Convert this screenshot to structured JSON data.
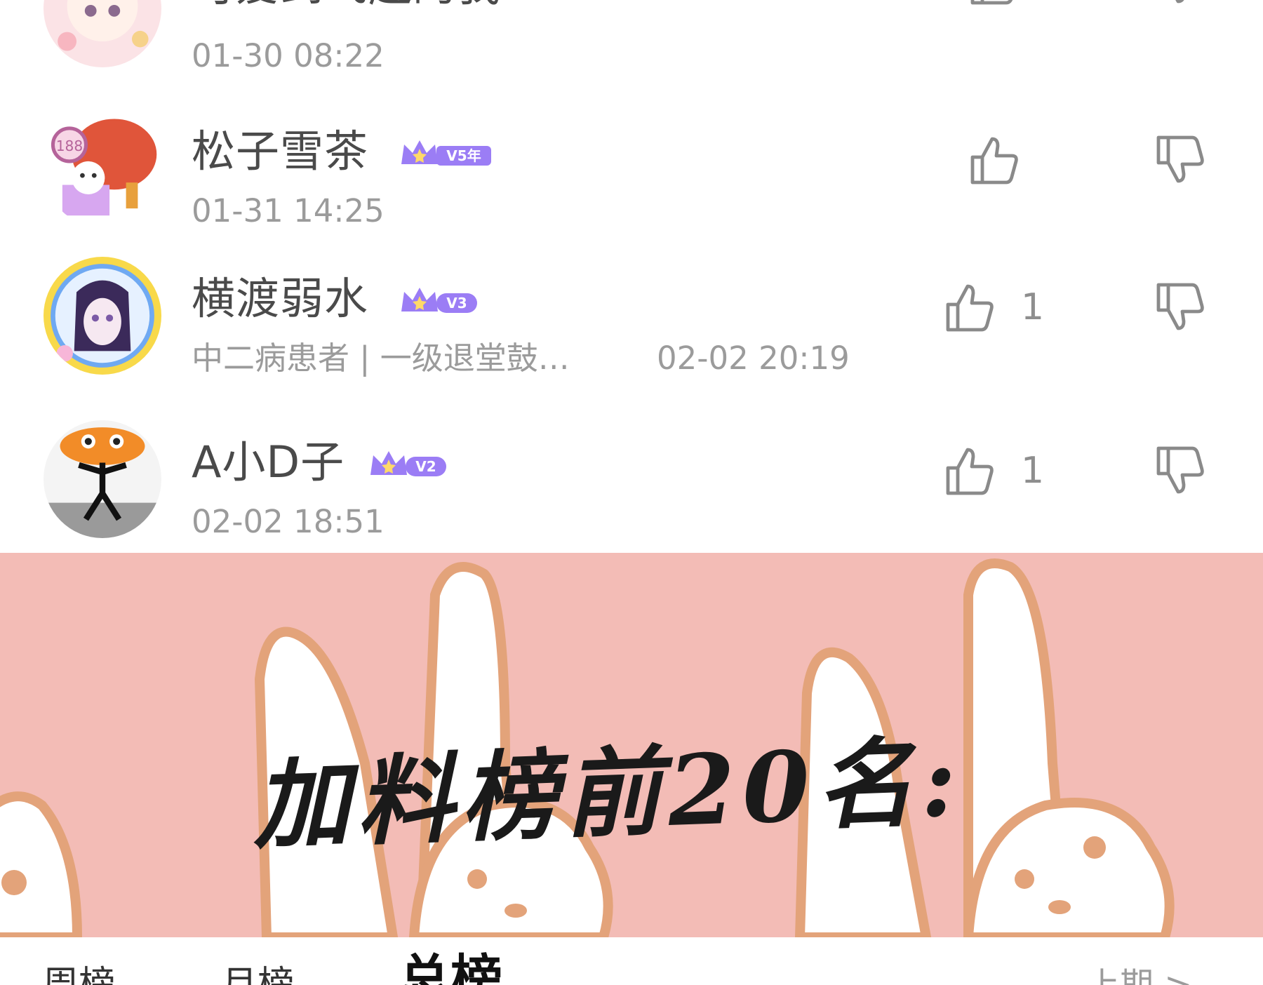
{
  "comments": [
    {
      "username": "可爱到飞起的我",
      "vip_level": "",
      "meta": "",
      "timestamp": "01-30 08:22",
      "likes": ""
    },
    {
      "username": "松子雪茶",
      "vip_level": "V5年",
      "meta": "",
      "timestamp": "01-31 14:25",
      "likes": ""
    },
    {
      "username": "横渡弱水",
      "vip_level": "V3",
      "meta": "中二病患者 | 一级退堂鼓…",
      "timestamp": "02-02 20:19",
      "likes": "1"
    },
    {
      "username": "A小D子",
      "vip_level": "V2",
      "meta": "",
      "timestamp": "02-02 18:51",
      "likes": "1"
    }
  ],
  "banner": {
    "title": "加料榜前20名:"
  },
  "tabs": {
    "weekly": "周榜",
    "monthly": "月榜",
    "total": "总榜",
    "last_period": "上期 >"
  },
  "colors": {
    "banner_bg": "#f3bcb6",
    "vip_purple": "#9b7df5",
    "text_gray": "#9b9b9b"
  }
}
